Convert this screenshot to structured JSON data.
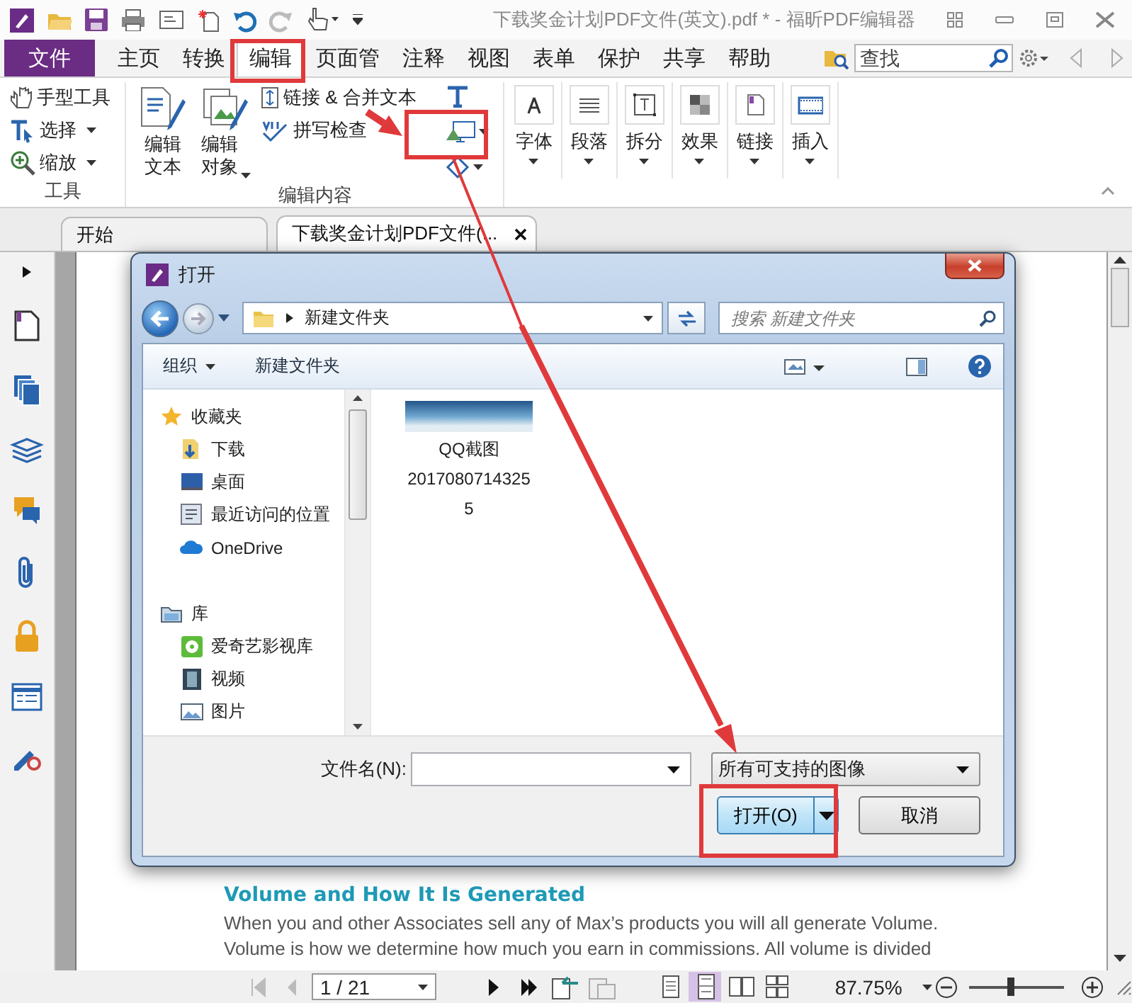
{
  "window": {
    "title": "下载奖金计划PDF文件(英文).pdf * - 福昕PDF编辑器"
  },
  "menu_tabs": [
    {
      "label": "文件",
      "kind": "file",
      "selected": false
    },
    {
      "label": "主页",
      "kind": "tab",
      "selected": false
    },
    {
      "label": "转换",
      "kind": "tab",
      "selected": false
    },
    {
      "label": "编辑",
      "kind": "tab",
      "selected": true
    },
    {
      "label": "页面管",
      "kind": "tab",
      "selected": false
    },
    {
      "label": "注释",
      "kind": "tab",
      "selected": false
    },
    {
      "label": "视图",
      "kind": "tab",
      "selected": false
    },
    {
      "label": "表单",
      "kind": "tab",
      "selected": false
    },
    {
      "label": "保护",
      "kind": "tab",
      "selected": false
    },
    {
      "label": "共享",
      "kind": "tab",
      "selected": false
    },
    {
      "label": "帮助",
      "kind": "tab",
      "selected": false
    }
  ],
  "search": {
    "placeholder": "查找"
  },
  "ribbon": {
    "groups": [
      {
        "label": "工具",
        "items": [
          {
            "label": "手型工具",
            "dropdown": false
          },
          {
            "label": "选择",
            "dropdown": true
          },
          {
            "label": "缩放",
            "dropdown": true
          }
        ]
      },
      {
        "label": "编辑内容",
        "large": [
          {
            "label": "编辑文本",
            "dropdown": false
          },
          {
            "label": "编辑对象",
            "dropdown": true
          }
        ],
        "items": [
          {
            "label": "链接 & 合并文本",
            "dropdown": false
          },
          {
            "label": "拼写检查",
            "dropdown": false
          }
        ],
        "icon_buttons": [
          {
            "dropdown": false
          },
          {
            "dropdown": true
          },
          {
            "dropdown": true
          }
        ]
      }
    ],
    "buttons": [
      {
        "label": "字体",
        "dropdown": true
      },
      {
        "label": "段落",
        "dropdown": true
      },
      {
        "label": "拆分",
        "dropdown": true
      },
      {
        "label": "效果",
        "dropdown": true
      },
      {
        "label": "链接",
        "dropdown": true
      },
      {
        "label": "插入",
        "dropdown": true
      }
    ]
  },
  "doc_tabs": [
    {
      "label": "开始",
      "selected": false,
      "closable": false
    },
    {
      "label": "下载奖金计划PDF文件(...",
      "selected": true,
      "closable": true
    }
  ],
  "document": {
    "heading": "Volume and How It Is Generated",
    "paragraph": "When you and other Associates sell any of Max’s products you will all generate Volume.\nVolume is how we determine how much you earn in commissions. All volume is divided"
  },
  "dialog": {
    "title": "打开",
    "path": "新建文件夹",
    "search_placeholder": "搜索 新建文件夹",
    "toolbar": [
      {
        "label": "组织",
        "dropdown": true
      },
      {
        "label": "新建文件夹",
        "dropdown": false
      }
    ],
    "nav_tree": [
      {
        "label": "收藏夹",
        "children": [
          {
            "label": "下载"
          },
          {
            "label": "桌面"
          },
          {
            "label": "最近访问的位置"
          },
          {
            "label": "OneDrive"
          }
        ]
      },
      {
        "label": "库",
        "children": [
          {
            "label": "爱奇艺影视库"
          },
          {
            "label": "视频"
          },
          {
            "label": "图片"
          }
        ]
      }
    ],
    "files": [
      {
        "name": "QQ截图20170807143255"
      }
    ],
    "filename_label": "文件名(N):",
    "file_type": "所有可支持的图像",
    "buttons": [
      {
        "label": "打开(O)",
        "kind": "split"
      },
      {
        "label": "取消",
        "kind": "plain"
      }
    ]
  },
  "status": {
    "page": "1 / 21",
    "zoom": "87.75%",
    "zoom_slider": {
      "level": 0.43
    },
    "view_modes": [
      {
        "selected": false
      },
      {
        "selected": true
      },
      {
        "selected": false
      },
      {
        "selected": false
      }
    ]
  }
}
